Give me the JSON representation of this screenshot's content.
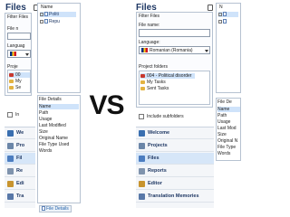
{
  "vs_label": "VS",
  "left": {
    "title": "Files",
    "filter_label": "Filter Files",
    "filename_label": "File n",
    "language_label": "Languag",
    "projects_label": "Proje",
    "folder_items": [
      "00",
      "My",
      "Se"
    ],
    "include_label": "In",
    "list_header": "Name",
    "list_rows": [
      "Politi",
      "Repu"
    ],
    "details_title": "File Details",
    "details_rows": [
      "Name",
      "Path",
      "Usage",
      "Last Modified",
      "Size",
      "Original Name",
      "File Type Used",
      "Words"
    ],
    "details_tab": "File Details",
    "nav": [
      "We",
      "Pro",
      "Fil",
      "Re",
      "Edi",
      "Tra"
    ]
  },
  "right": {
    "title": "Files",
    "filter_label": "Filter Files",
    "filename_label": "File name:",
    "language_label": "Language:",
    "language_value": "Romanian (Romania)",
    "projects_label": "Project folders",
    "folder_items": [
      "004 - Political disorder",
      "My Tasks",
      "Sent Tasks"
    ],
    "include_label": "Include subfolders",
    "list_header": "N",
    "details_title": "File De",
    "details_rows": [
      "Name",
      "Path",
      "Usage",
      "Last Mod",
      "Size",
      "Original N",
      "File Type",
      "Words"
    ],
    "nav": [
      "Welcome",
      "Projects",
      "Files",
      "Reports",
      "Editor",
      "Translation Memories"
    ]
  },
  "colors": {
    "accent": "#1f3864",
    "selection": "#cfe3fa",
    "nav_active": "#d6e6f8",
    "border": "#b6c2d1"
  }
}
